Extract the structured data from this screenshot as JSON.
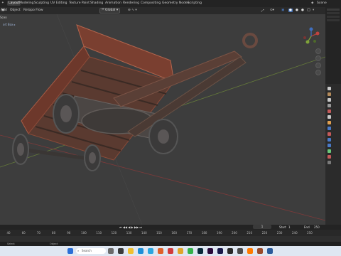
{
  "topbar": {
    "tabs": [
      "Layout",
      "Modeling",
      "Sculpting",
      "UV Editing",
      "Texture Paint",
      "Shading",
      "Animation",
      "Rendering",
      "Compositing",
      "Geometry Nodes",
      "Scripting"
    ],
    "active_tab": "Layout",
    "scene_label": "Scene"
  },
  "header": {
    "add": "Add",
    "object": "Object",
    "mode": "Retopo Flow",
    "transform": "Global",
    "options": "Options"
  },
  "outliner": {
    "label": "Scen"
  },
  "timeline": {
    "ticks": [
      "40",
      "60",
      "70",
      "80",
      "90",
      "100",
      "110",
      "120",
      "130",
      "140",
      "150",
      "160",
      "170",
      "180",
      "190",
      "200",
      "210",
      "220",
      "230",
      "240",
      "250"
    ],
    "current_frame": "1",
    "start_label": "Start",
    "start_value": "1",
    "end_label": "End",
    "end_value": "250"
  },
  "statusbar": {
    "left": "Select",
    "right": "Object"
  },
  "taskbar": {
    "search": "Search"
  },
  "colors": {
    "accent": "#4772b3",
    "axis_x": "#a33a3a",
    "axis_y": "#7fa33a",
    "rust": "#9a4c38"
  }
}
